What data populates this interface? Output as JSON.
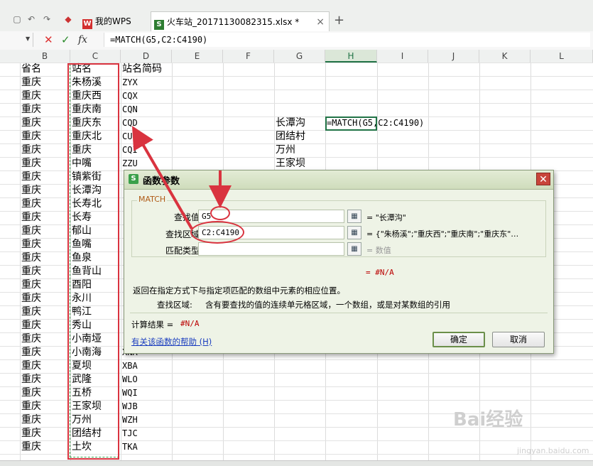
{
  "quick_access": [
    "undo",
    "redo"
  ],
  "tabs": [
    {
      "label": "我的WPS",
      "icon": "wps-logo-icon"
    },
    {
      "label": "火车站_20171130082315.xlsx *",
      "icon": "spreadsheet-icon"
    }
  ],
  "formula_bar": {
    "fx_label": "fx",
    "formula": "=MATCH(G5,C2:C4190)"
  },
  "columns": [
    "B",
    "C",
    "D",
    "E",
    "F",
    "G",
    "H",
    "I",
    "J",
    "K",
    "L"
  ],
  "selected_column": "H",
  "sheet": {
    "header_row": [
      "省名",
      "站名",
      "站名简码"
    ],
    "rows": [
      [
        "重庆",
        "朱杨溪",
        "ZYX"
      ],
      [
        "重庆",
        "重庆西",
        "CQX"
      ],
      [
        "重庆",
        "重庆南",
        "CQN"
      ],
      [
        "重庆",
        "重庆东",
        "CQD"
      ],
      [
        "重庆",
        "重庆北",
        "CU"
      ],
      [
        "重庆",
        "重庆",
        "CQI"
      ],
      [
        "重庆",
        "中嘴",
        "ZZU"
      ],
      [
        "重庆",
        "镇紫街",
        ""
      ],
      [
        "重庆",
        "长潭沟",
        ""
      ],
      [
        "重庆",
        "长寿北",
        ""
      ],
      [
        "重庆",
        "长寿",
        ""
      ],
      [
        "重庆",
        "郁山",
        ""
      ],
      [
        "重庆",
        "鱼嘴",
        ""
      ],
      [
        "重庆",
        "鱼泉",
        ""
      ],
      [
        "重庆",
        "鱼背山",
        ""
      ],
      [
        "重庆",
        "酉阳",
        ""
      ],
      [
        "重庆",
        "永川",
        ""
      ],
      [
        "重庆",
        "鸭江",
        ""
      ],
      [
        "重庆",
        "秀山",
        ""
      ],
      [
        "重庆",
        "小南垭",
        ""
      ],
      [
        "重庆",
        "小南海",
        "XNA"
      ],
      [
        "重庆",
        "夏坝",
        "XBA"
      ],
      [
        "重庆",
        "武隆",
        "WLO"
      ],
      [
        "重庆",
        "五桥",
        "WQI"
      ],
      [
        "重庆",
        "王家坝",
        "WJB"
      ],
      [
        "重庆",
        "万州",
        "WZH"
      ],
      [
        "重庆",
        "团结村",
        "TJC"
      ],
      [
        "重庆",
        "土坎",
        "TKA"
      ]
    ],
    "g_column": [
      "长潭沟",
      "团结村",
      "万州",
      "王家坝"
    ],
    "h5_value": "=MATCH(G5,C2:C4190)"
  },
  "dialog": {
    "title": "函数参数",
    "function_name": "MATCH",
    "args": [
      {
        "label": "查找值",
        "value": "G5",
        "result": "= \"长潭沟\""
      },
      {
        "label": "查找区域",
        "value": "C2:C4190",
        "result": "= {\"朱杨溪\";\"重庆西\";\"重庆南\";\"重庆东\"…"
      },
      {
        "label": "匹配类型",
        "value": "",
        "result": "= 数值"
      }
    ],
    "inline_result": "= #N/A",
    "description": "返回在指定方式下与指定项匹配的数组中元素的相应位置。",
    "param_label": "查找区域:",
    "param_description": "含有要查找的值的连续单元格区域，一个数组，或是对某数组的引用",
    "calc_label": "计算结果 =",
    "calc_value": "#N/A",
    "help_link": "有关该函数的帮助 (H)",
    "ok_label": "确定",
    "cancel_label": "取消"
  },
  "watermark": {
    "main": "Bai经验",
    "sub": "jingyan.baidu.com"
  },
  "colors": {
    "annotation_red": "#d9333f",
    "accent_green": "#217346",
    "error_red": "#bb0000"
  }
}
